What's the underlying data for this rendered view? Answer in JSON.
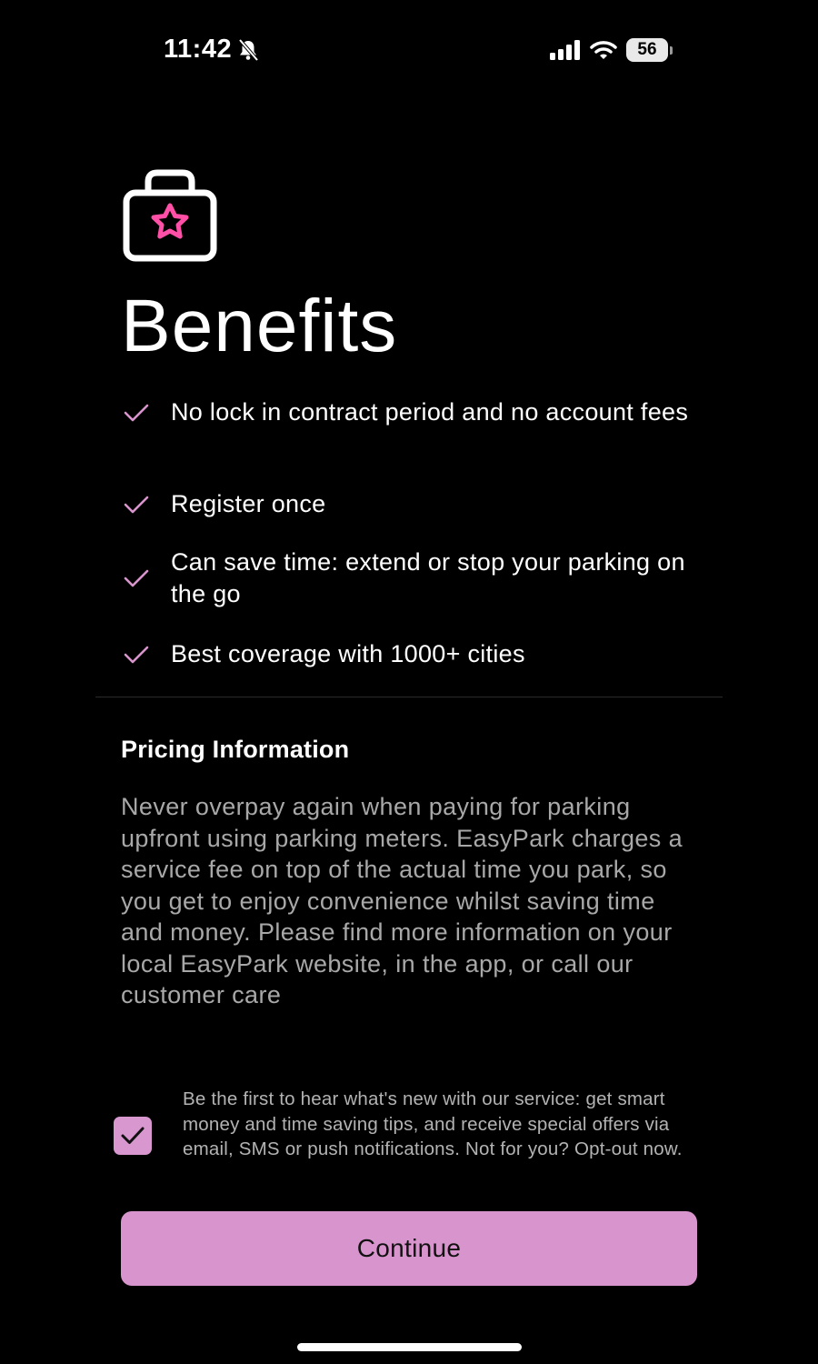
{
  "status_bar": {
    "time": "11:42",
    "battery": "56",
    "icons": [
      "bell-slash-icon",
      "cellular-signal-icon",
      "wifi-icon",
      "battery-icon"
    ]
  },
  "header": {
    "icon": "shopping-bag-star-icon",
    "title": "Benefits"
  },
  "benefits": [
    {
      "text": "No lock in contract period and no account fees",
      "icon": "check-icon"
    },
    {
      "text": "Register once",
      "icon": "check-icon"
    },
    {
      "text": "Can save time: extend or stop your parking on the go",
      "icon": "check-icon"
    },
    {
      "text": "Best coverage with 1000+ cities",
      "icon": "check-icon"
    }
  ],
  "pricing": {
    "title": "Pricing Information",
    "body": "Never overpay again when paying for parking upfront using parking meters. EasyPark charges a service fee on top of the actual time you park, so you get to enjoy convenience whilst saving time and money. Please find more information on your local EasyPark website, in the app, or call our customer care"
  },
  "opt_in": {
    "checked": true,
    "text": "Be the first to hear what's new with our service: get smart money and time saving tips, and receive special offers via email, SMS or push notifications. Not for you? Opt-out now."
  },
  "continue_button": {
    "label": "Continue"
  },
  "colors": {
    "accent": "#d895cd",
    "icon_pink": "#ff4fa6",
    "background": "#000000",
    "secondary_text": "#a8a8a8"
  }
}
